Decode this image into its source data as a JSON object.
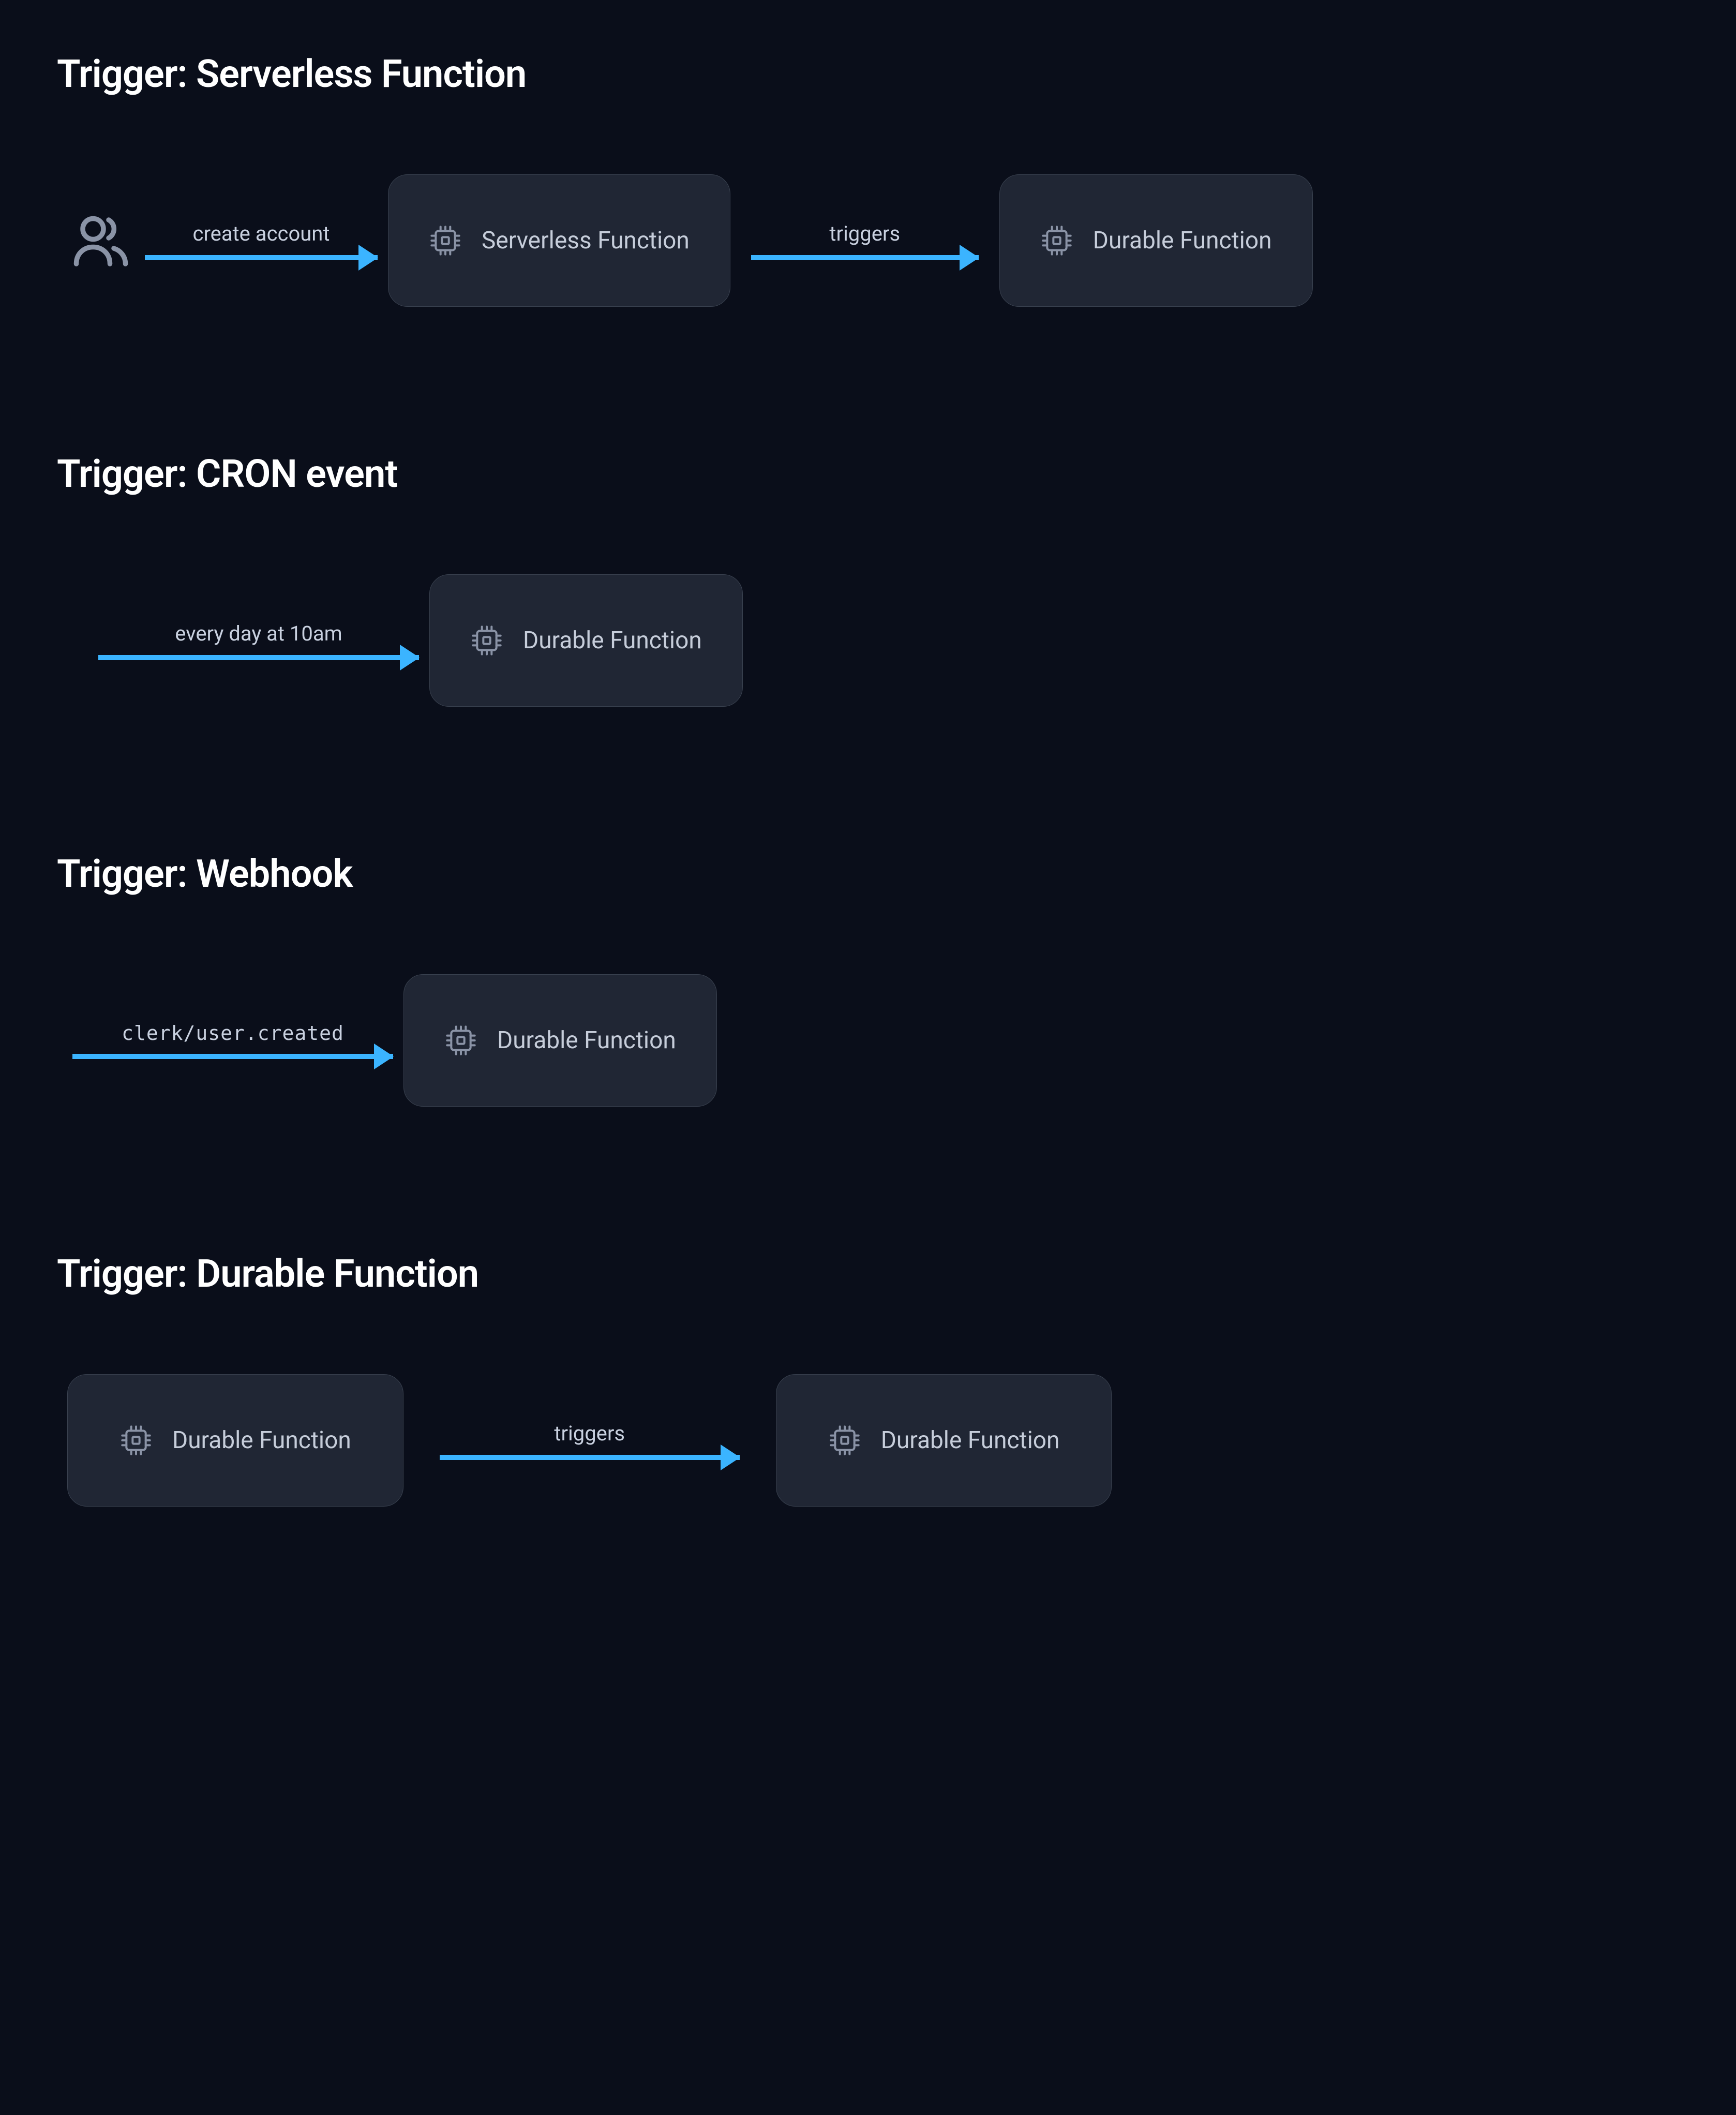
{
  "colors": {
    "background": "#0a0e1a",
    "box_bg": "#202634",
    "box_border": "#39414f",
    "text_heading": "#ffffff",
    "text_muted": "#c6cdda",
    "arrow": "#3bb4ff",
    "icon_stroke": "#8a93a6"
  },
  "sections": {
    "serverless": {
      "title": "Trigger: Serverless Function",
      "icon": "users-icon",
      "arrow1_label": "create account",
      "box1_label": "Serverless Function",
      "arrow2_label": "triggers",
      "box2_label": "Durable Function"
    },
    "cron": {
      "title": "Trigger: CRON event",
      "arrow_label": "every day at 10am",
      "box_label": "Durable Function"
    },
    "webhook": {
      "title": "Trigger: Webhook",
      "arrow_label": "clerk/user.created",
      "box_label": "Durable Function"
    },
    "durable": {
      "title": "Trigger: Durable Function",
      "box1_label": "Durable Function",
      "arrow_label": "triggers",
      "box2_label": "Durable Function"
    }
  }
}
